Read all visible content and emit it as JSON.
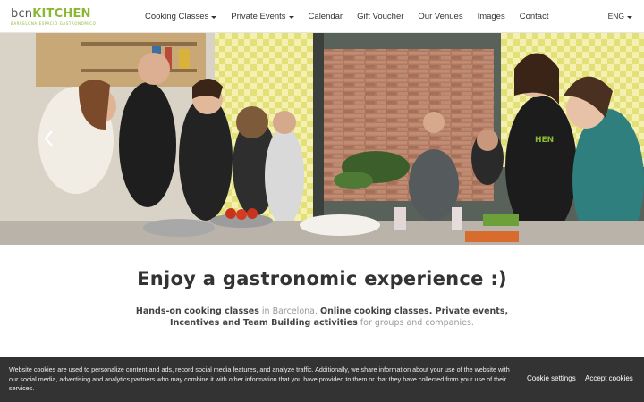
{
  "brand": {
    "logo_prefix": "bcn",
    "logo_main": "KITCHEN",
    "logo_tagline": "BARCELONA  ESPACIO GASTRONÓMICO",
    "accent_color": "#8ab833"
  },
  "nav": {
    "items": [
      {
        "label": "Cooking Classes",
        "dropdown": true
      },
      {
        "label": "Private Events",
        "dropdown": true
      },
      {
        "label": "Calendar",
        "dropdown": false
      },
      {
        "label": "Gift Voucher",
        "dropdown": false
      },
      {
        "label": "Our Venues",
        "dropdown": false
      },
      {
        "label": "Images",
        "dropdown": false
      },
      {
        "label": "Contact",
        "dropdown": false
      }
    ],
    "language": "ENG"
  },
  "hero": {
    "arrow_icon": "chevron-left-icon",
    "apron_text": "HEN"
  },
  "main": {
    "headline": "Enjoy a gastronomic experience :)",
    "sub_part1_bold": "Hands-on cooking classes",
    "sub_part2": " in Barcelona. ",
    "sub_part3_bold": "Online cooking classes. Private events, Incentives and Team Building activities",
    "sub_part4": " for groups and companies."
  },
  "cookie_banner": {
    "text": "Website cookies are used to personalize content and ads, record social media features, and analyze traffic. Additionally, we share information about your use of the website with our social media, advertising and analytics partners who may combine it with other information that you have provided to them or that they have collected from your use of their services.",
    "settings_label": "Cookie settings",
    "accept_label": "Accept cookies"
  }
}
